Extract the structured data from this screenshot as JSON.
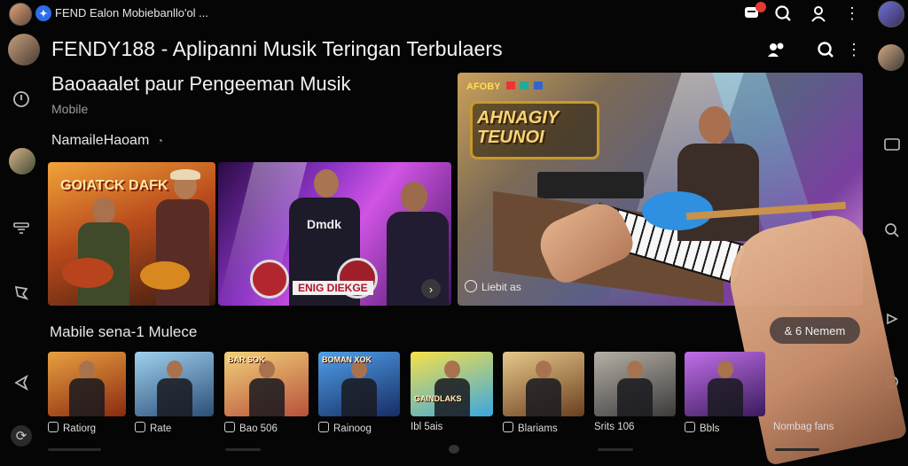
{
  "status_bar": {
    "app_label": "FEND Ealon Mobiebanllo'ol ..."
  },
  "header": {
    "title": "FENDY188 - Aplipanni Musik Teringan Terbulaers",
    "subtitle": "Baoaaalet paur Pengeeman Musik",
    "platform": "Mobile"
  },
  "sections": {
    "featured_title": "NamaileHaoam",
    "row_title": "Mabile sena-1 Mulece"
  },
  "featured": {
    "card1_title": "GOIATCK DAFK",
    "card2_banner": "ENIG DIEKGE",
    "card2_shirt": "Dmdk",
    "main_logo": "AHNAGIY TEUNOI",
    "main_tag": "AFOBY",
    "main_caption": "Liebit as"
  },
  "overlay_button": {
    "label": "& 6 Nemem"
  },
  "row": {
    "items": [
      {
        "caption": "Ratiorg"
      },
      {
        "caption": "Rate"
      },
      {
        "caption": "Bao 506"
      },
      {
        "caption": "Rainoog"
      },
      {
        "caption": "Ibl 5ais"
      },
      {
        "caption": "Blariams"
      },
      {
        "caption": "Srits 106"
      },
      {
        "caption": "Bbls"
      },
      {
        "caption": "Nombag fans"
      }
    ],
    "posters": [
      "",
      "",
      "BAR SOK",
      "BOMAN XOK",
      "GAINDLAKS",
      "",
      "",
      ""
    ]
  },
  "colors": {
    "background": "#050505",
    "accent": "#2b6de8",
    "notification": "#e53935"
  }
}
